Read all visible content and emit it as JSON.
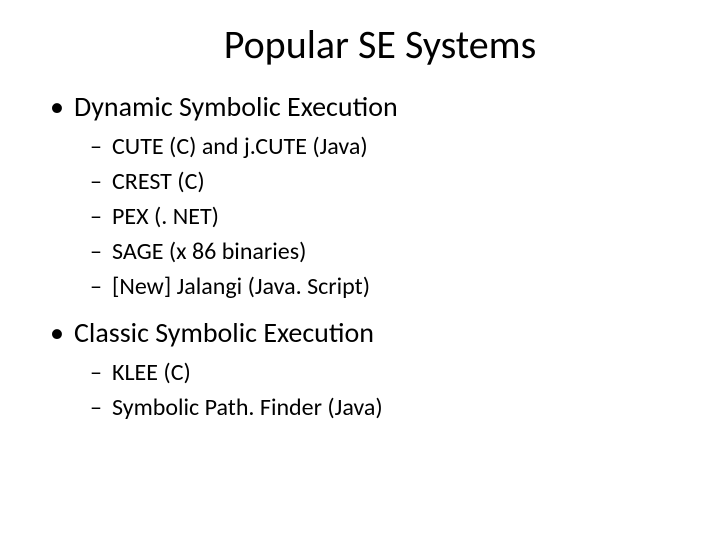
{
  "title": "Popular SE Systems",
  "sections": [
    {
      "heading": "Dynamic Symbolic Execution",
      "items": [
        "CUTE (C) and j.CUTE (Java)",
        "CREST (C)",
        "PEX (. NET)",
        "SAGE (x 86 binaries)",
        "[New] Jalangi (Java. Script)"
      ]
    },
    {
      "heading": "Classic Symbolic Execution",
      "items": [
        "KLEE (C)",
        "Symbolic Path. Finder (Java)"
      ]
    }
  ]
}
